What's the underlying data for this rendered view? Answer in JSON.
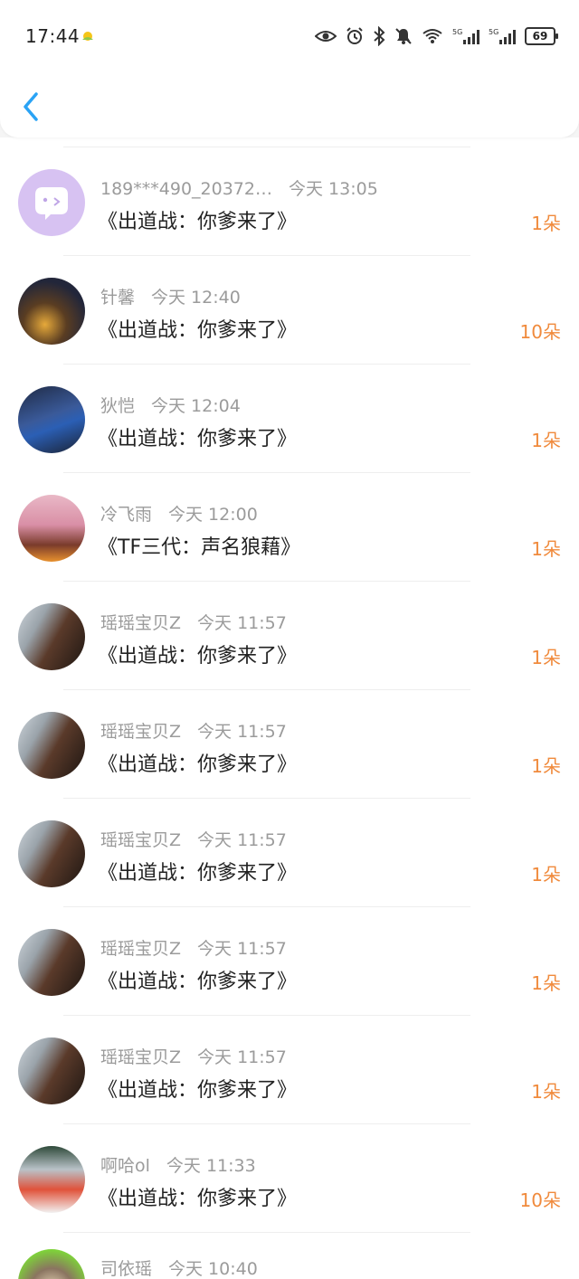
{
  "status_bar": {
    "time": "17:44",
    "battery": "69",
    "icons": [
      "weather-icon",
      "eye-icon",
      "alarm-icon",
      "bluetooth-icon",
      "mute-icon",
      "wifi-icon",
      "signal-5g-icon",
      "signal-5g-icon",
      "battery-icon"
    ]
  },
  "header": {
    "back_icon": "chevron-left-icon",
    "accent": "#2aa3f5"
  },
  "accent_count_color": "#f08a3c",
  "rows": [
    {
      "user": "189***490_20372…",
      "time": "今天 13:05",
      "title": "《出道战：你爹来了》",
      "count": "1朵"
    },
    {
      "user": "针馨",
      "time": "今天 12:40",
      "title": "《出道战：你爹来了》",
      "count": "10朵"
    },
    {
      "user": "狄恺",
      "time": "今天 12:04",
      "title": "《出道战：你爹来了》",
      "count": "1朵"
    },
    {
      "user": "冷飞雨",
      "time": "今天 12:00",
      "title": "《TF三代：声名狼藉》",
      "count": "1朵"
    },
    {
      "user": "瑶瑶宝贝Z",
      "time": "今天 11:57",
      "title": "《出道战：你爹来了》",
      "count": "1朵"
    },
    {
      "user": "瑶瑶宝贝Z",
      "time": "今天 11:57",
      "title": "《出道战：你爹来了》",
      "count": "1朵"
    },
    {
      "user": "瑶瑶宝贝Z",
      "time": "今天 11:57",
      "title": "《出道战：你爹来了》",
      "count": "1朵"
    },
    {
      "user": "瑶瑶宝贝Z",
      "time": "今天 11:57",
      "title": "《出道战：你爹来了》",
      "count": "1朵"
    },
    {
      "user": "瑶瑶宝贝Z",
      "time": "今天 11:57",
      "title": "《出道战：你爹来了》",
      "count": "1朵"
    },
    {
      "user": "啊哈ol",
      "time": "今天 11:33",
      "title": "《出道战：你爹来了》",
      "count": "10朵"
    },
    {
      "user": "司依瑶",
      "time": "今天 10:40",
      "title": "",
      "count": ""
    }
  ]
}
